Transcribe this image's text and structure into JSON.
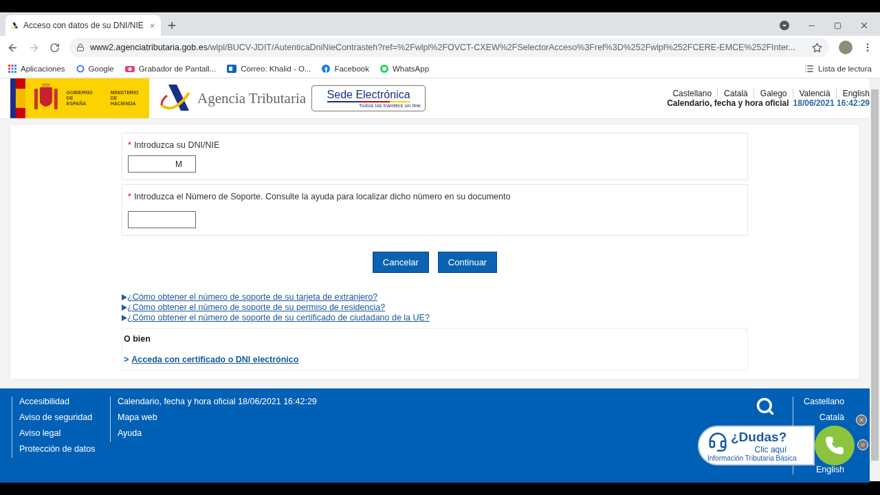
{
  "browser": {
    "tab": {
      "title": "Acceso con datos de su DNI/NIE",
      "selected": true
    },
    "url_host": "www2.agenciatributaria.gob.es",
    "url_path": "/wlpl/BUCV-JDIT/AutenticaDniNieContrasteh?ref=%2Fwlpl%2FOVCT-CXEW%2FSelectorAcceso%3Fref%3D%252Fwlpl%252FCERE-EMCE%252FInter...",
    "bookmarks": [
      {
        "label": "Aplicaciones",
        "kind": "apps"
      },
      {
        "label": "Google",
        "kind": "google"
      },
      {
        "label": "Grabador de Pantall...",
        "kind": "recorder"
      },
      {
        "label": "Correo: Khalid  - O...",
        "kind": "mail"
      },
      {
        "label": "Facebook",
        "kind": "facebook"
      },
      {
        "label": "WhatsApp",
        "kind": "whatsapp"
      }
    ],
    "reading_list": "Lista de lectura"
  },
  "header": {
    "gov_line1": "GOBIERNO",
    "gov_line2": "DE ESPAÑA",
    "ministry_line1": "MINISTERIO",
    "ministry_line2": "DE HACIENDA",
    "agency": "Agencia Tributaria",
    "sede_title": "Sede Electrónica",
    "sede_subtitle": "Todos los trámites on line",
    "languages": [
      "Castellano",
      "Català",
      "Galego",
      "Valencià",
      "English"
    ],
    "clock_label": "Calendario, fecha y hora oficial",
    "clock_value": "18/06/2021 16:42:29"
  },
  "form": {
    "fields": [
      {
        "required_mark": "*",
        "label": "Introduzca su DNI/NIE",
        "value": "M"
      },
      {
        "required_mark": "*",
        "label": "Introduzca el Número de Soporte. Consulte la ayuda para localizar dicho número en su documento"
      }
    ],
    "buttons": [
      "Cancelar",
      "Continuar"
    ],
    "help_links": [
      "¿Cómo obtener el número de soporte de su tarjeta de extranjero?",
      "¿Cómo obtener el número de soporte de su permiso de residencia?",
      "¿Cómo obtener el número de soporte de su certificado de ciudadano de la UE?"
    ],
    "alt_title": "O bien",
    "alt_prefix": ">",
    "alt_link": "Acceda con certificado o DNI electrónico"
  },
  "footer": {
    "column_1": [
      "Accesibilidad",
      "Aviso de seguridad",
      "Aviso legal",
      "Protección de datos"
    ],
    "column_2": [
      "Calendario, fecha y hora oficial 18/06/2021 16:42:29",
      "Mapa web",
      "Ayuda"
    ],
    "languages": [
      "Castellano",
      "Català",
      "English"
    ]
  },
  "help_widget": {
    "title": "¿Dudas?",
    "action": "Clic aquí",
    "subtitle": "Información Tributaria Básica"
  }
}
